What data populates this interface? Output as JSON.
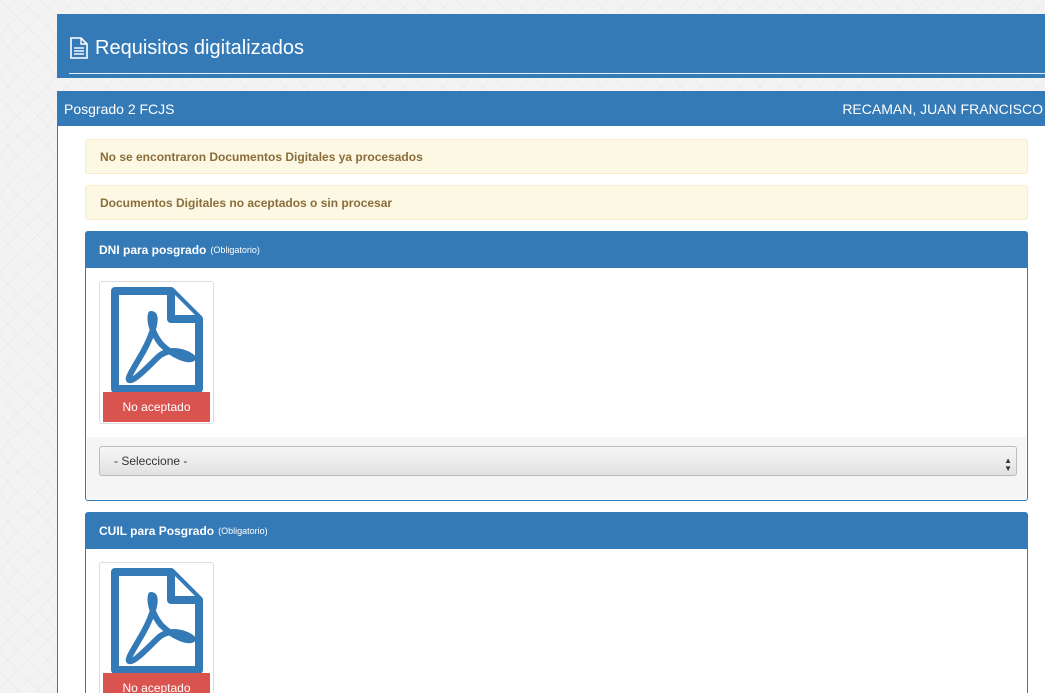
{
  "header": {
    "title": "Requisitos digitalizados",
    "icon": "file-text-icon"
  },
  "main_panel": {
    "left_title": "Posgrado 2 FCJS",
    "right_title": "RECAMAN, JUAN FRANCISCO"
  },
  "alerts": [
    "No se encontraron Documentos Digitales ya procesados",
    "Documentos Digitales no aceptados o sin procesar"
  ],
  "requirements": [
    {
      "name": "DNI para posgrado",
      "tag": "(Obligatorio)",
      "document_icon": "pdf-file-icon",
      "status": "No aceptado",
      "select_value": "- Seleccione -"
    },
    {
      "name": "CUIL para Posgrado",
      "tag": "(Obligatorio)",
      "document_icon": "pdf-file-icon",
      "status": "No aceptado"
    }
  ],
  "colors": {
    "primary": "#337ab7",
    "warning_bg": "#fcf8e3",
    "warning_text": "#8a6d3b",
    "danger": "#d9534f"
  }
}
